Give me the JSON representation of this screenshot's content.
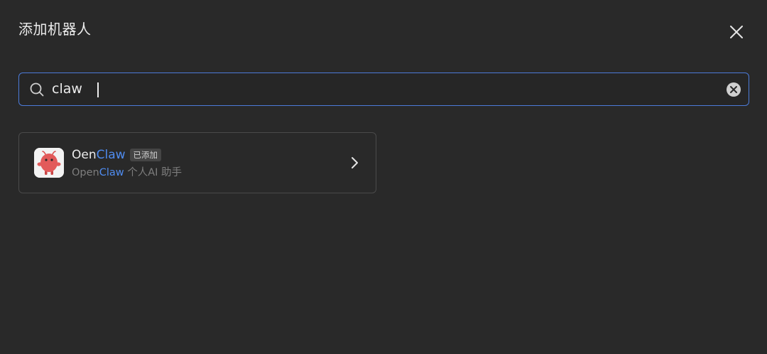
{
  "dialog": {
    "title": "添加机器人"
  },
  "search": {
    "value": "claw",
    "placeholder": ""
  },
  "results": [
    {
      "name_prefix": "Oen",
      "name_highlight": "Claw",
      "badge": "已添加",
      "desc_prefix": "Open",
      "desc_highlight": "Claw",
      "desc_suffix": " 个人AI 助手"
    }
  ],
  "icons": {
    "close": "close-icon",
    "search": "search-icon",
    "clear": "clear-circle-icon",
    "avatar": "red-creature-avatar",
    "chevron": "chevron-right-icon"
  },
  "colors": {
    "background": "#292929",
    "accent": "#4f8cf0",
    "search_border": "#4c7bd9"
  }
}
